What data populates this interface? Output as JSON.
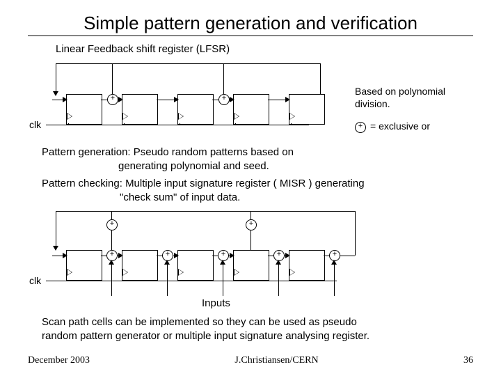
{
  "title": "Simple pattern generation and verification",
  "lfsr_heading": "Linear Feedback shift register (LFSR)",
  "clk_label": "clk",
  "side_note_line1": "Based on polynomial",
  "side_note_line2": "division.",
  "xor_legend": "= exclusive or",
  "pattern_gen_l1": "Pattern generation: Pseudo random patterns based on",
  "pattern_gen_l2": "generating polynomial and seed.",
  "pattern_chk_l1": "Pattern checking: Multiple input signature register ( MISR ) generating",
  "pattern_chk_l2": "\"check sum\" of input data.",
  "inputs_label": "Inputs",
  "final_l1": "Scan path cells can be implemented so they can be used as pseudo",
  "final_l2": "random pattern generator or multiple input signature analysing register.",
  "footer_left": "December 2003",
  "footer_center": "J.Christiansen/CERN",
  "footer_right": "36"
}
